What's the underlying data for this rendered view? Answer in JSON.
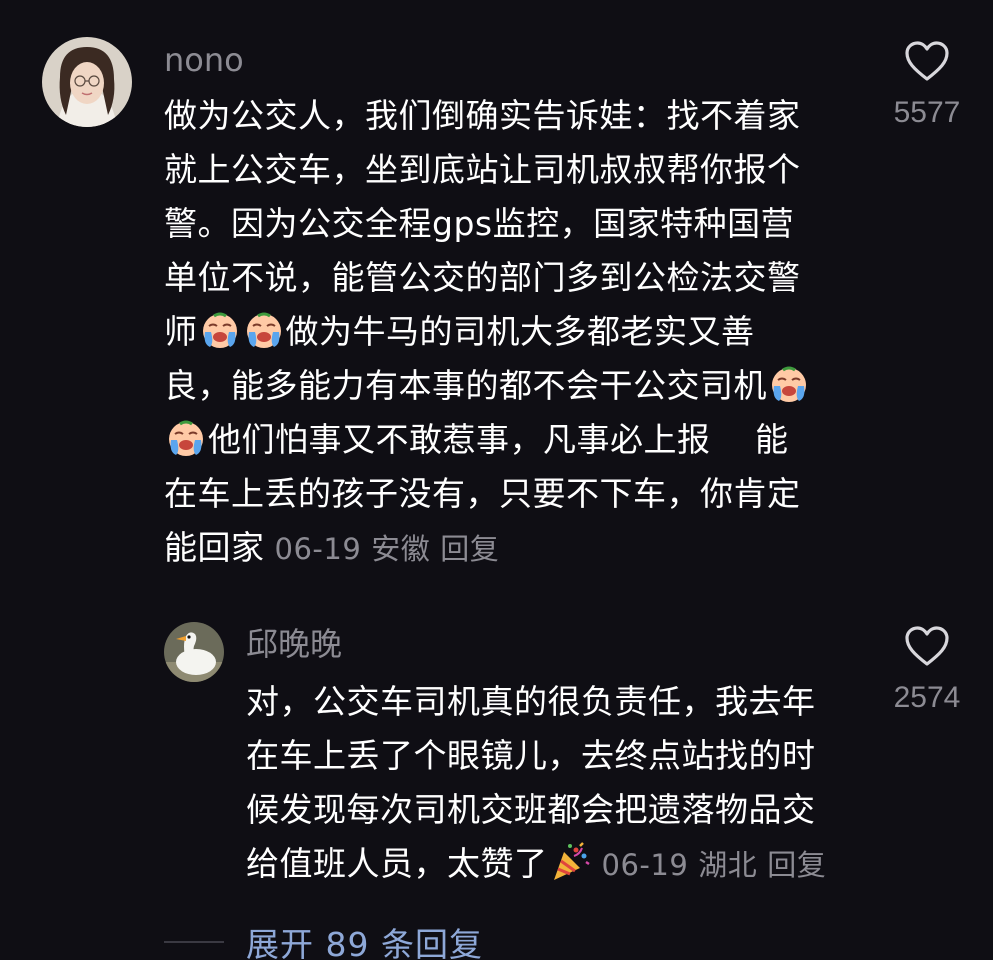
{
  "main_comment": {
    "username": "nono",
    "lines": [
      "做为公交人，我们倒确实告诉娃：找不着家",
      "就上公交车，坐到底站让司机叔叔帮你报个",
      "警。因为公交全程gps监控，国家特种国营",
      "单位不说，能管公交的部门多到公检法交警",
      [
        "师",
        "做为牛马的司机大多都老实又善"
      ],
      [
        "良，能多能力有本事的都不会干公交司机",
        ""
      ],
      [
        "",
        "他们怕事又不敢惹事，凡事必上报　 能"
      ],
      "在车上丢的孩子没有，只要不下车，你肯定",
      "能回家"
    ],
    "date": "06-19",
    "location": "安徽",
    "reply_label": "回复",
    "likes": "5577"
  },
  "reply_comment": {
    "username": "邱晚晚",
    "lines": [
      "对，公交车司机真的很负责任，我去年",
      "在车上丢了个眼镜儿，去终点站找的时",
      "候发现每次司机交班都会把遗落物品交",
      "给值班人员，太赞了"
    ],
    "date": "06-19",
    "location": "湖北",
    "reply_label": "回复",
    "likes": "2574"
  },
  "expand": {
    "label": "展开 89 条回复"
  },
  "icons": {
    "like": "heart-outline-icon",
    "emoji_cry": "crying-face-emoji",
    "emoji_party": "party-popper-emoji"
  },
  "colors": {
    "background": "#0f0e14",
    "secondary_text": "#8c8b93",
    "link": "#8ea8d8"
  }
}
